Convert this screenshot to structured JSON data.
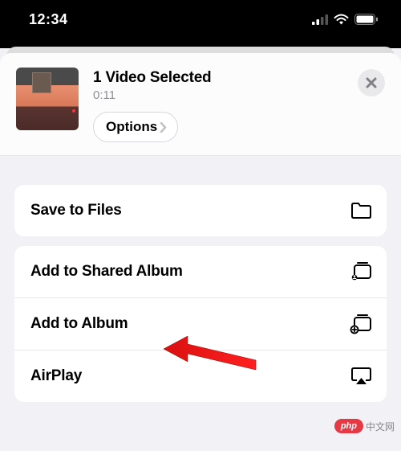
{
  "status": {
    "time": "12:34"
  },
  "header": {
    "title": "1 Video Selected",
    "subtitle": "0:11",
    "options_label": "Options"
  },
  "actions": {
    "group1": [
      {
        "label": "Save to Files",
        "icon": "folder-icon"
      }
    ],
    "group2": [
      {
        "label": "Add to Shared Album",
        "icon": "shared-album-icon"
      },
      {
        "label": "Add to Album",
        "icon": "add-album-icon"
      },
      {
        "label": "AirPlay",
        "icon": "airplay-icon"
      }
    ]
  },
  "watermark": {
    "brand": "php",
    "text": "中文网"
  }
}
